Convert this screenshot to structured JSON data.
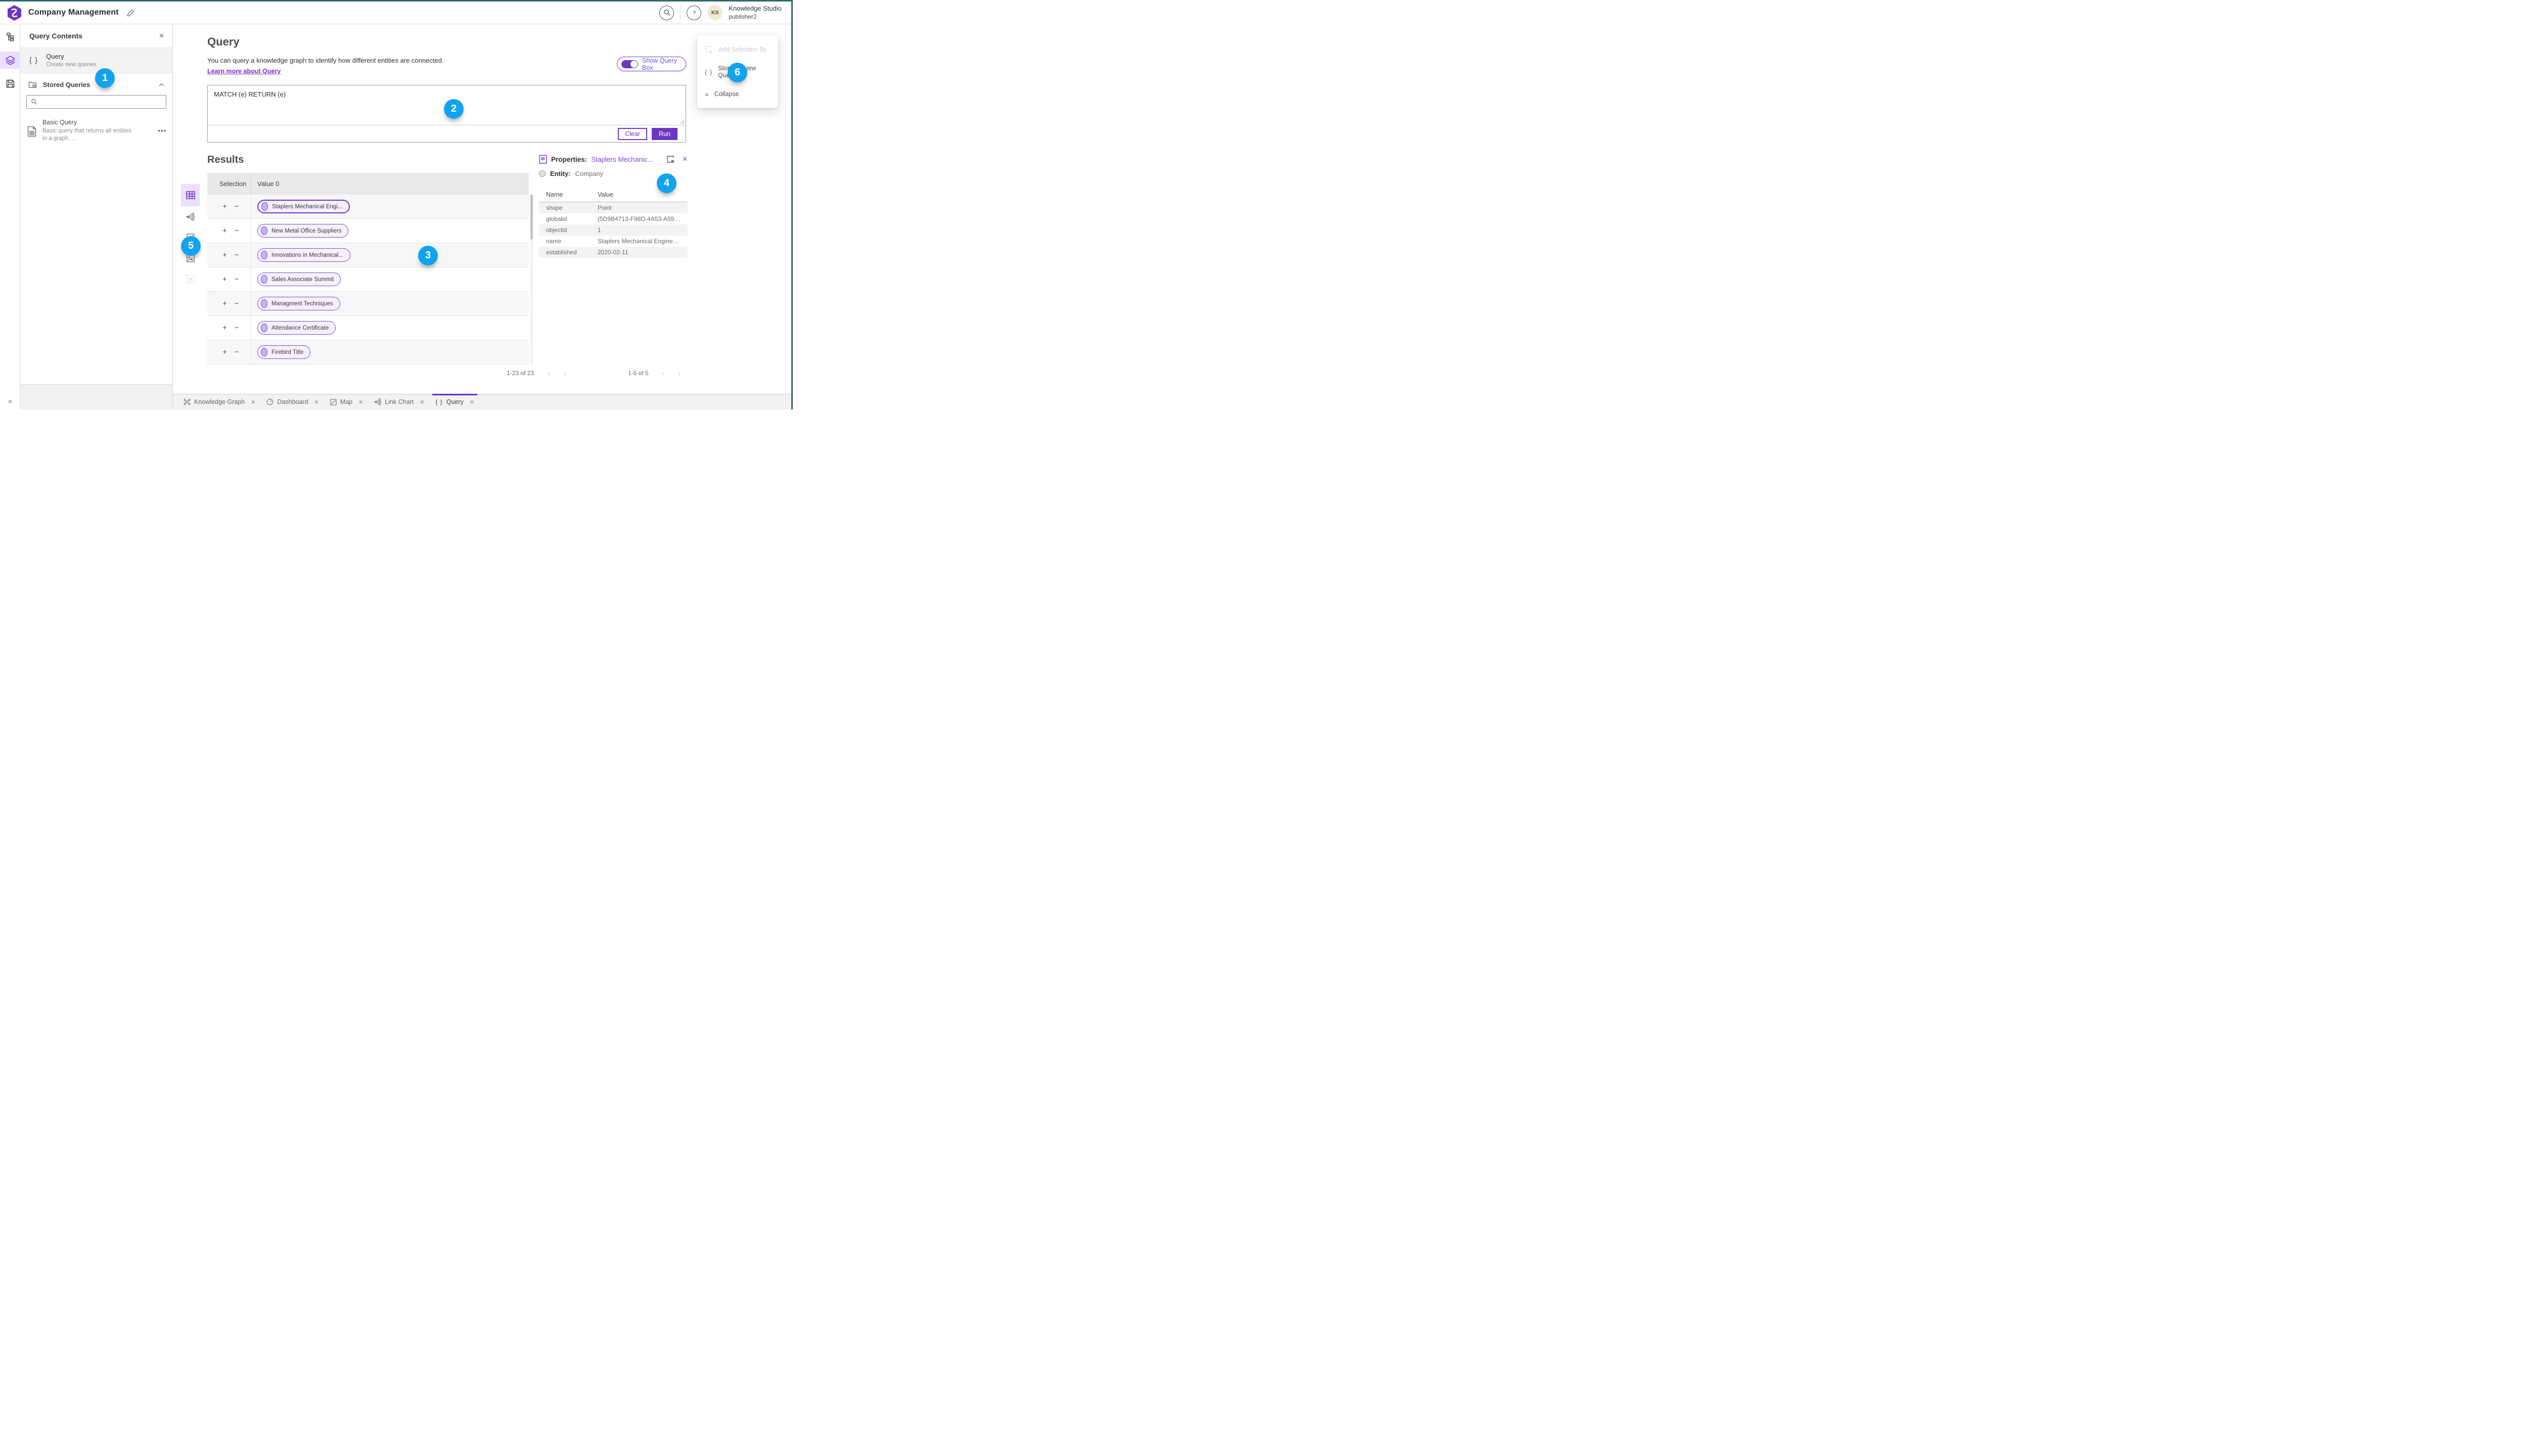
{
  "header": {
    "title": "Company Management",
    "org_name": "Knowledge Studio",
    "user_name": "publisher2",
    "avatar_initials": "KS"
  },
  "contents_panel": {
    "title": "Query Contents",
    "query_item_title": "Query",
    "query_item_subtitle": "Create new queries",
    "stored_queries_title": "Stored Queries",
    "search_placeholder": "",
    "stored_items": [
      {
        "title": "Basic Query",
        "description": "Basic query that returns all entities in a graph. ..."
      }
    ]
  },
  "query_section": {
    "heading": "Query",
    "description": "You can query a knowledge graph to identify how different entities are connected.",
    "learn_more_label": "Learn more about Query",
    "show_query_box_label": "Show Query Box",
    "query_text": "MATCH (e) RETURN (e)",
    "clear_label": "Clear",
    "run_label": "Run"
  },
  "results_section": {
    "heading": "Results",
    "col_selection": "Selection",
    "col_value": "Value 0",
    "rows": [
      {
        "label": "Staplers Mechanical Engi...",
        "selected": true
      },
      {
        "label": "New Metal Office Suppliers",
        "selected": false
      },
      {
        "label": "Innovations in Mechanical...",
        "selected": false
      },
      {
        "label": "Sales Associate Summit",
        "selected": false
      },
      {
        "label": "Managment Techniques",
        "selected": false
      },
      {
        "label": "Attendance Certificate",
        "selected": false
      },
      {
        "label": "Firebird Title",
        "selected": false
      }
    ],
    "pagination": "1-23 of 23"
  },
  "properties_panel": {
    "label": "Properties:",
    "entity_link": "Staplers Mechanic...",
    "entity_label": "Entity:",
    "entity_type": "Company",
    "col_name": "Name",
    "col_value": "Value",
    "rows": [
      {
        "name": "shape",
        "value": "Point"
      },
      {
        "name": "globalid",
        "value": "{5D9B4713-F98D-4A53-A59F-C1..."
      },
      {
        "name": "objectid",
        "value": "1"
      },
      {
        "name": "name",
        "value": "Staplers Mechanical Engineering"
      },
      {
        "name": "established",
        "value": "2020-02-11"
      }
    ],
    "pagination": "1-5 of 5"
  },
  "context_menu": {
    "items": [
      {
        "label": "Add Selection To",
        "disabled": true
      },
      {
        "label": "Store as New Query",
        "disabled": false
      },
      {
        "label": "Collapse",
        "disabled": false
      }
    ]
  },
  "tab_bar": {
    "tabs": [
      {
        "label": "Knowledge Graph",
        "active": false
      },
      {
        "label": "Dashboard",
        "active": false
      },
      {
        "label": "Map",
        "active": false
      },
      {
        "label": "Link Chart",
        "active": false
      },
      {
        "label": "Query",
        "active": true
      }
    ]
  },
  "annotations": [
    {
      "n": "1"
    },
    {
      "n": "2"
    },
    {
      "n": "3"
    },
    {
      "n": "4"
    },
    {
      "n": "5"
    },
    {
      "n": "6"
    }
  ],
  "colors": {
    "accent_purple": "#6a38c2",
    "link_purple": "#7d45d6",
    "annotation_blue": "#12a3f0",
    "frame_teal": "#2f6a6d"
  }
}
